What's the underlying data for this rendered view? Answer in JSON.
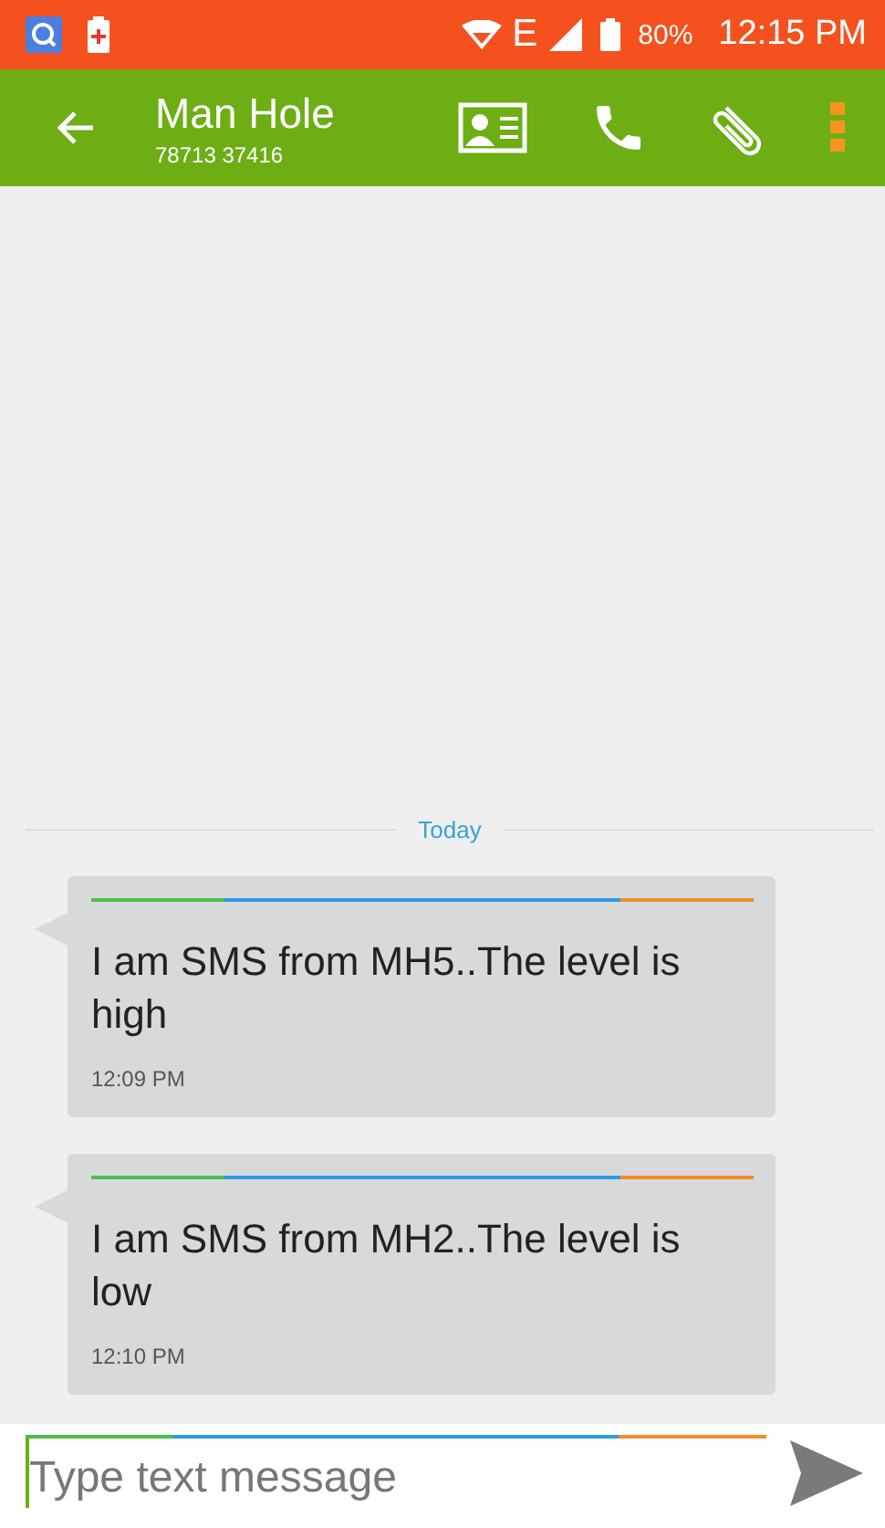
{
  "status_bar": {
    "network": "E",
    "battery": "80%",
    "time": "12:15 PM"
  },
  "app_bar": {
    "title": "Man Hole",
    "subtitle": "78713 37416"
  },
  "divider_label": "Today",
  "messages": [
    {
      "text": "I am SMS from MH5..The level is high",
      "time": "12:09 PM"
    },
    {
      "text": "I am SMS from MH2..The level is low",
      "time": "12:10 PM"
    }
  ],
  "composer": {
    "placeholder": "Type text message"
  }
}
